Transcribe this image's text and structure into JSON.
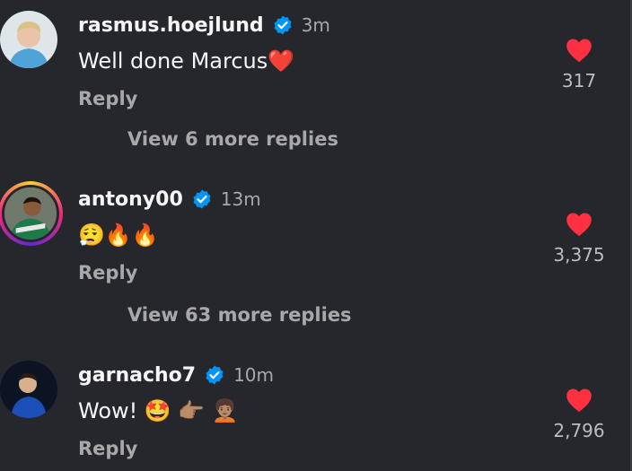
{
  "comments": [
    {
      "username": "rasmus.hoejlund",
      "time": "3m",
      "text": "Well done Marcus",
      "text_emoji": "❤️",
      "reply_label": "Reply",
      "likes": "317",
      "view_replies": "View 6 more replies",
      "avatar_icon": "player-light-blue-jersey-avatar"
    },
    {
      "username": "antony00",
      "time": "13m",
      "text": "",
      "text_emoji": "😮‍💨🔥🔥",
      "reply_label": "Reply",
      "likes": "3,375",
      "view_replies": "View 63 more replies",
      "avatar_icon": "player-green-jersey-avatar"
    },
    {
      "username": "garnacho7",
      "time": "10m",
      "text": "Wow!",
      "text_emoji": "🤩 👉🏽 🧑🏽‍🦱",
      "reply_label": "Reply",
      "likes": "2,796",
      "avatar_icon": "player-blue-kit-avatar"
    }
  ],
  "colors": {
    "background": "#25272c",
    "heart": "#ff3040",
    "verified": "#0095f6",
    "secondary_text": "#a8a8a8"
  }
}
